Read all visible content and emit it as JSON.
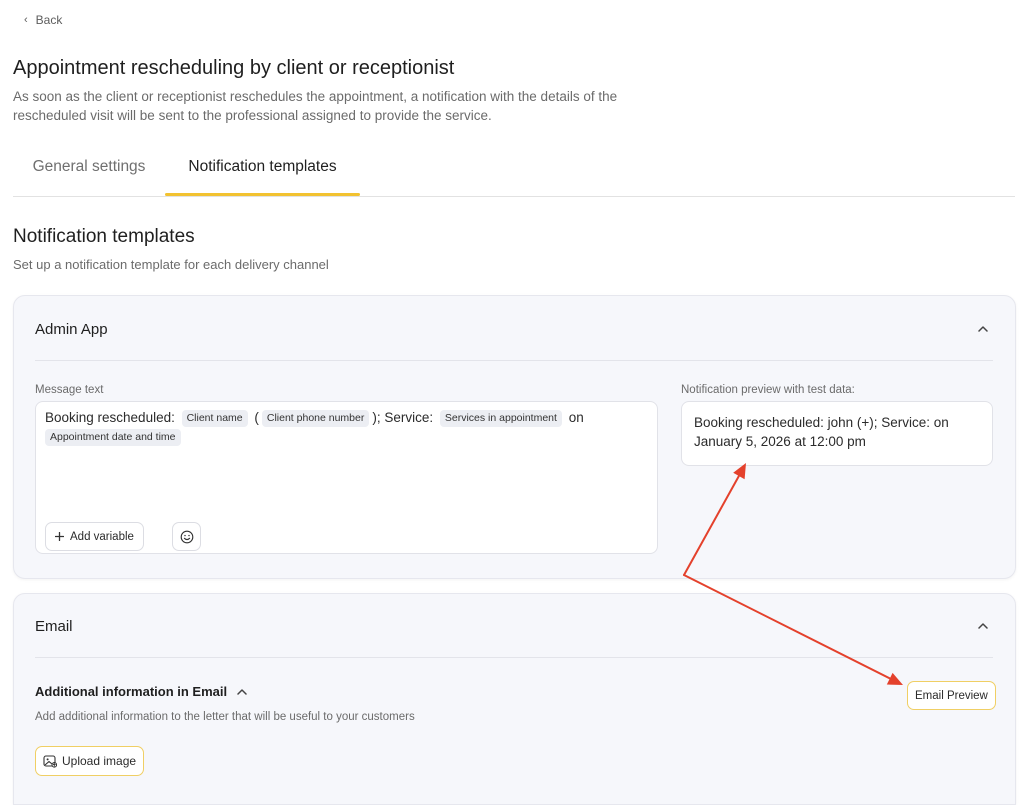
{
  "nav": {
    "back_label": "Back"
  },
  "header": {
    "title": "Appointment rescheduling by client or receptionist",
    "description": "As soon as the client or receptionist reschedules the appointment, a notification with the details of the rescheduled visit will be sent to the professional assigned to provide the service."
  },
  "tabs": [
    {
      "label": "General settings",
      "active": false
    },
    {
      "label": "Notification templates",
      "active": true
    }
  ],
  "section": {
    "title": "Notification templates",
    "subtitle": "Set up a notification template for each delivery channel"
  },
  "admin_app": {
    "title": "Admin App",
    "message_label": "Message text",
    "message": {
      "text_1": "Booking rescheduled: ",
      "var_client_name": "Client name",
      "text_2": " (",
      "var_client_phone": "Client phone number",
      "text_3": "); Service: ",
      "var_services": "Services in appointment",
      "text_4": " on ",
      "var_datetime": "Appointment date and time"
    },
    "add_variable_label": "Add variable",
    "preview_label": "Notification preview with test data:",
    "preview_text": "Booking rescheduled: john (+); Service:  on January 5, 2026 at 12:00 pm"
  },
  "email": {
    "title": "Email",
    "additional_title": "Additional information in Email",
    "additional_desc": "Add additional information to the letter that will be useful to your customers",
    "preview_button_label": "Email Preview",
    "upload_label": "Upload image"
  },
  "colors": {
    "accent": "#f2c230",
    "annotation_arrow": "#e4412c",
    "card_bg": "#f6f7fb"
  },
  "icons": {
    "back": "chevron-left-icon",
    "collapse": "chevron-up-icon",
    "add": "plus-icon",
    "emoji": "smiley-icon",
    "upload": "image-upload-icon"
  }
}
